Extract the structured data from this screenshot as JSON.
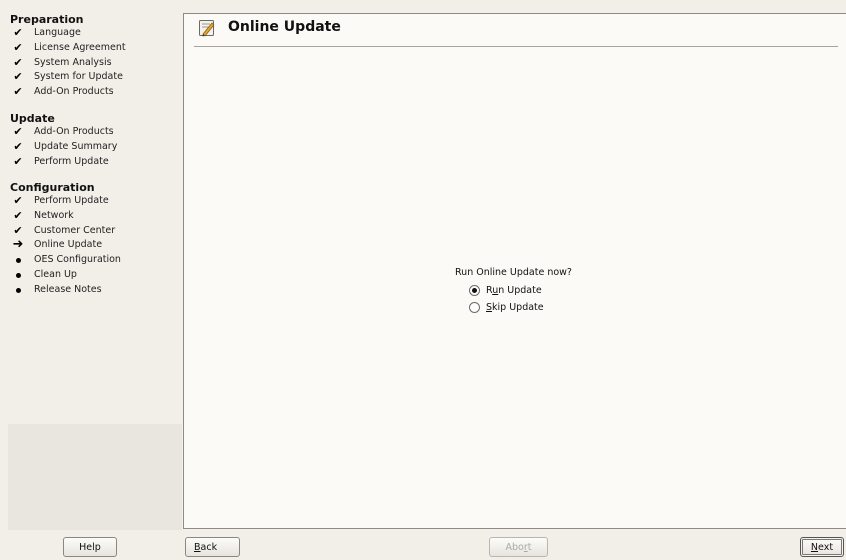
{
  "sidebar": {
    "groups": [
      {
        "title": "Preparation",
        "steps": [
          {
            "label": "Language",
            "status": "done"
          },
          {
            "label": "License Agreement",
            "status": "done"
          },
          {
            "label": "System Analysis",
            "status": "done"
          },
          {
            "label": "System for Update",
            "status": "done"
          },
          {
            "label": "Add-On Products",
            "status": "done"
          }
        ]
      },
      {
        "title": "Update",
        "steps": [
          {
            "label": "Add-On Products",
            "status": "done"
          },
          {
            "label": "Update Summary",
            "status": "done"
          },
          {
            "label": "Perform Update",
            "status": "done"
          }
        ]
      },
      {
        "title": "Configuration",
        "steps": [
          {
            "label": "Perform Update",
            "status": "done"
          },
          {
            "label": "Network",
            "status": "done"
          },
          {
            "label": "Customer Center",
            "status": "done"
          },
          {
            "label": "Online Update",
            "status": "current"
          },
          {
            "label": "OES Configuration",
            "status": "pending"
          },
          {
            "label": "Clean Up",
            "status": "pending"
          },
          {
            "label": "Release Notes",
            "status": "pending"
          }
        ]
      }
    ]
  },
  "main": {
    "title": "Online Update",
    "icon": "edit-document-icon",
    "question": "Run Online Update now?",
    "options": [
      {
        "pre": "R",
        "mnemonic": "u",
        "post": "n Update",
        "checked": true
      },
      {
        "pre": "",
        "mnemonic": "S",
        "post": "kip Update",
        "checked": false
      }
    ]
  },
  "buttons": {
    "help": "Help",
    "back": {
      "mnemonic": "B",
      "rest": "ack"
    },
    "abort": {
      "pre": "Abo",
      "mnemonic": "r",
      "post": "t"
    },
    "next": {
      "mnemonic": "N",
      "rest": "ext"
    }
  },
  "marks": {
    "done": "✔",
    "current": "➜"
  }
}
